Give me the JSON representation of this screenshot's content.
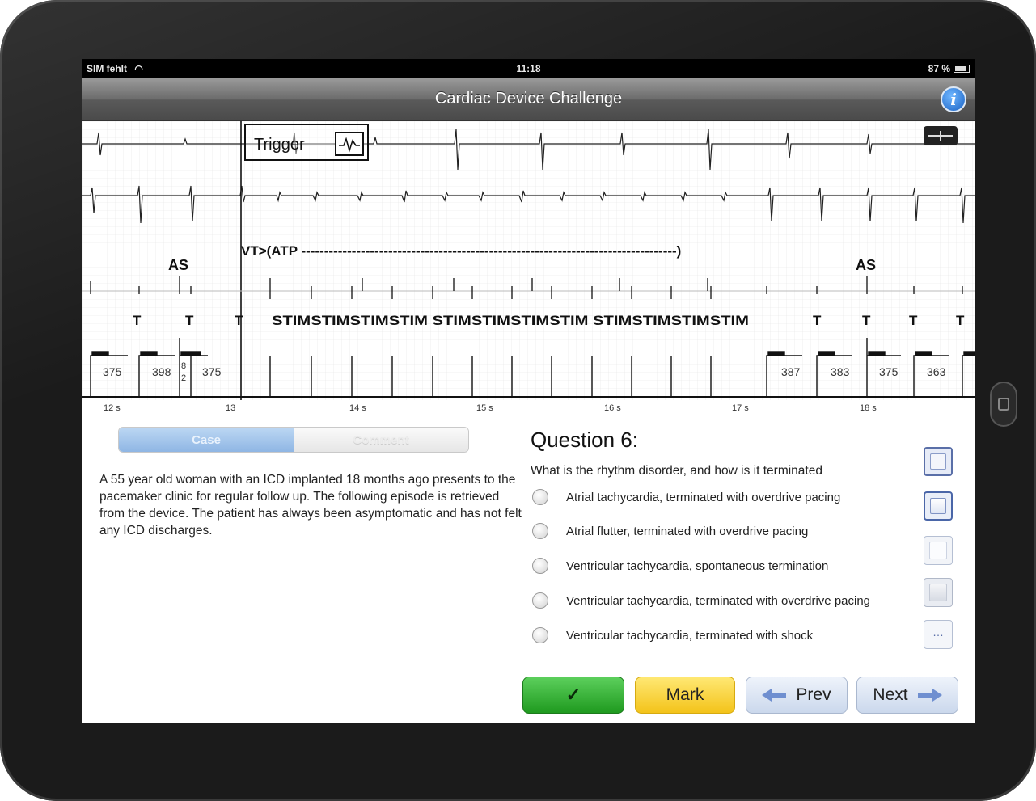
{
  "status_bar": {
    "carrier": "SIM fehlt",
    "time": "11:18",
    "battery": "87 %"
  },
  "nav": {
    "title": "Cardiac Device Challenge",
    "info_icon": "info-icon"
  },
  "ecg": {
    "trigger_label": "Trigger",
    "annotation": "VT>(ATP ----------------------------------------------------------------------------------)",
    "as_label_left": "AS",
    "as_label_right": "AS",
    "marker_labels_left": [
      "T",
      "T",
      "T"
    ],
    "stim_text": "STIMSTIMSTIMSTIM STIMSTIMSTIMSTIM STIMSTIMSTIMSTIM",
    "marker_labels_right": [
      "T",
      "T",
      "T",
      "T"
    ],
    "intervals_left": [
      "375",
      "398",
      "375"
    ],
    "interval_small": [
      "8",
      "2"
    ],
    "intervals_right": [
      "387",
      "383",
      "375",
      "363"
    ],
    "time_labels": [
      "12 s",
      "13",
      "14 s",
      "15 s",
      "16 s",
      "17 s",
      "18 s"
    ]
  },
  "tabs": {
    "case": "Case",
    "comment": "Comment"
  },
  "case_text": "A 55 year old woman with an ICD implanted 18 months ago presents to the pacemaker clinic for regular follow up. The following episode is retrieved from the device. The patient has always been asymptomatic and has not felt any ICD discharges.",
  "question": {
    "title": "Question 6:",
    "prompt": "What is the rhythm disorder, and how is it terminated",
    "options": [
      "Atrial tachycardia, terminated with overdrive pacing",
      "Atrial flutter, terminated with overdrive pacing",
      "Ventricular tachycardia, spontaneous termination",
      "Ventricular tachycardia, terminated with overdrive pacing",
      "Ventricular tachycardia, terminated with shock"
    ]
  },
  "buttons": {
    "submit": "✓",
    "mark": "Mark",
    "prev": "Prev",
    "next": "Next"
  },
  "colors": {
    "submit": "#2bab2b",
    "mark": "#f7d23a",
    "nav_buttons": "#d9e3f2",
    "accent": "#1a62c4"
  }
}
